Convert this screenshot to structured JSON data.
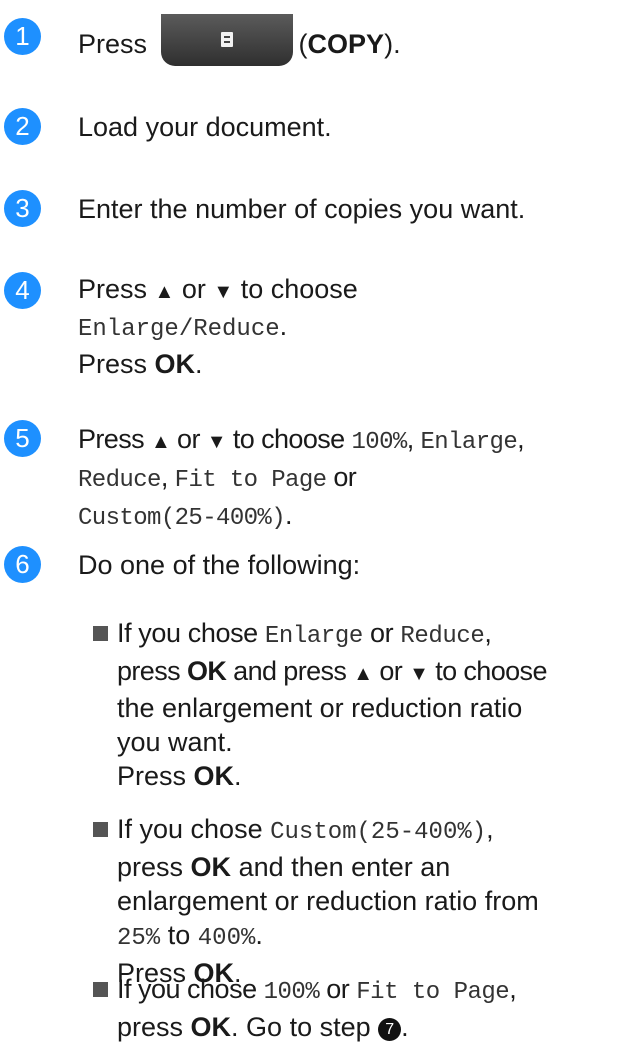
{
  "steps": [
    {
      "num": "1",
      "press": "Press",
      "copy_open": "(",
      "copy_label": "COPY",
      "copy_close": ")."
    },
    {
      "num": "2",
      "text": "Load your document."
    },
    {
      "num": "3",
      "text": "Enter the number of copies you want."
    },
    {
      "num": "4",
      "press": "Press",
      "up": "▲",
      "or": "or",
      "down": "▼",
      "to_choose": "to choose",
      "option": "Enlarge/Reduce",
      "period": ".",
      "press2": "Press",
      "ok": "OK",
      "period2": "."
    },
    {
      "num": "5",
      "press": "Press",
      "up": "▲",
      "or": "or",
      "down": "▼",
      "to_choose": "to choose",
      "opt1": "100%",
      "comma1": ",",
      "opt2": "Enlarge",
      "comma2": ",",
      "opt3": "Reduce",
      "comma3": ",",
      "opt4": "Fit to Page",
      "or2": "or",
      "opt5": "Custom(25-400%)",
      "period": "."
    },
    {
      "num": "6",
      "text": "Do one of the following:"
    }
  ],
  "bullets": [
    {
      "if_chose": "If you chose",
      "opt1": "Enlarge",
      "or": "or",
      "opt2": "Reduce",
      "comma": ",",
      "press": "press",
      "ok": "OK",
      "and_press": "and press",
      "up": "▲",
      "or2": "or",
      "down": "▼",
      "to_choose": "to choose",
      "rest1": "the enlargement or reduction ratio",
      "rest2": "you want.",
      "press2": "Press",
      "ok2": "OK",
      "period": "."
    },
    {
      "if_chose": "If you chose",
      "opt1": "Custom(25-400%)",
      "comma": ",",
      "press": "press",
      "ok": "OK",
      "then": "and then enter an",
      "rest1": "enlargement or reduction ratio from",
      "from": "25%",
      "to": "to",
      "until": "400%",
      "period": ".",
      "press2": "Press",
      "ok2": "OK",
      "period2": "."
    },
    {
      "if_chose": "If you chose",
      "opt1": "100%",
      "or": "or",
      "opt2": "Fit to Page",
      "comma": ",",
      "press": "press",
      "ok": "OK",
      "goto": ". Go to step",
      "step_ref": "7",
      "period": "."
    }
  ]
}
